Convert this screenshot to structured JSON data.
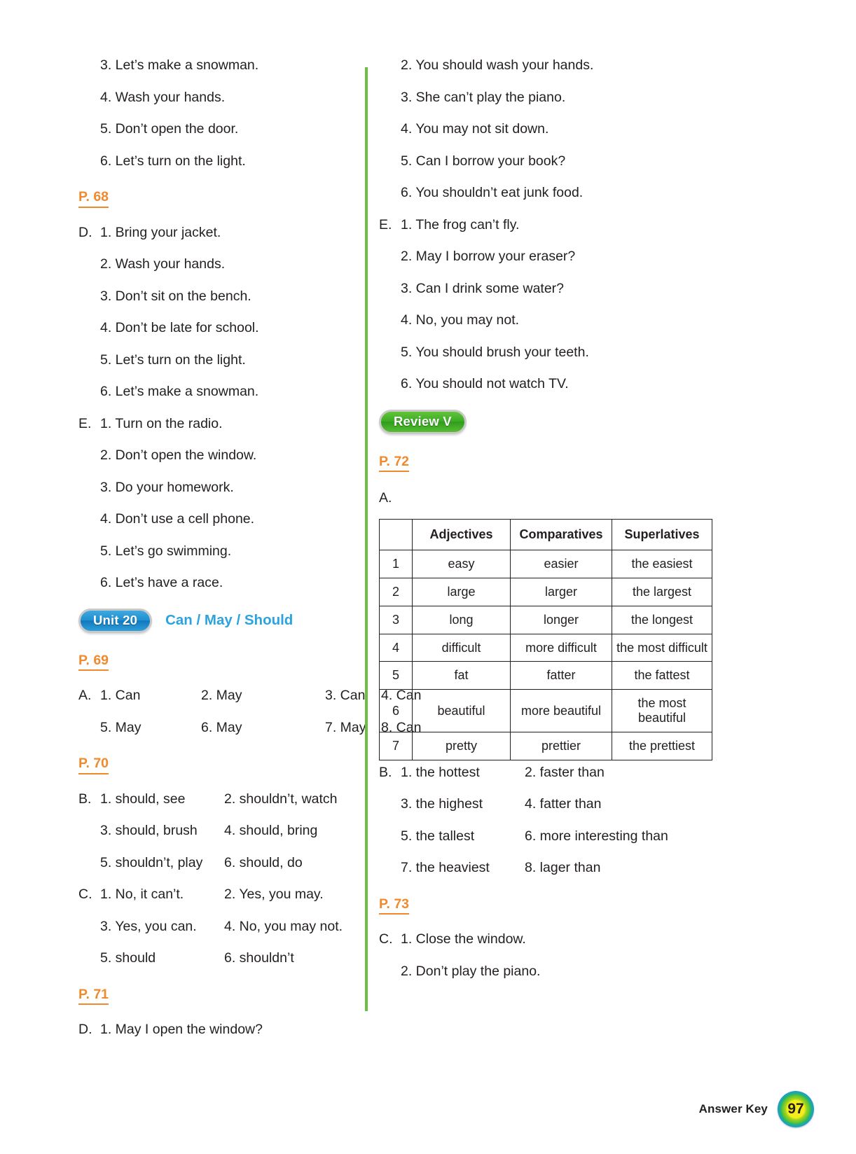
{
  "left_column": {
    "blocks": [
      {
        "type": "answers",
        "rows": [
          {
            "letter": "",
            "items": [
              "3. Let’s make a snowman."
            ]
          },
          {
            "letter": "",
            "items": [
              "4. Wash your hands."
            ]
          },
          {
            "letter": "",
            "items": [
              "5. Don’t open the door."
            ]
          },
          {
            "letter": "",
            "items": [
              "6. Let’s turn on the light."
            ]
          }
        ]
      },
      {
        "type": "page_marker",
        "label": "P. 68"
      },
      {
        "type": "answers",
        "rows": [
          {
            "letter": "D.",
            "items": [
              "1. Bring your jacket."
            ]
          },
          {
            "letter": "",
            "items": [
              "2. Wash your hands."
            ]
          },
          {
            "letter": "",
            "items": [
              "3. Don’t sit on the bench."
            ]
          },
          {
            "letter": "",
            "items": [
              "4. Don’t be late for school."
            ]
          },
          {
            "letter": "",
            "items": [
              "5. Let’s turn on the light."
            ]
          },
          {
            "letter": "",
            "items": [
              "6. Let’s make a snowman."
            ]
          },
          {
            "letter": "E.",
            "items": [
              "1. Turn on the radio."
            ]
          },
          {
            "letter": "",
            "items": [
              "2. Don’t open the window."
            ]
          },
          {
            "letter": "",
            "items": [
              "3. Do your homework."
            ]
          },
          {
            "letter": "",
            "items": [
              "4. Don’t use a cell phone."
            ]
          },
          {
            "letter": "",
            "items": [
              "5. Let’s go swimming."
            ]
          },
          {
            "letter": "",
            "items": [
              "6. Let’s have a race."
            ]
          }
        ]
      },
      {
        "type": "unit",
        "badge": "Unit 20",
        "title": "Can / May / Should",
        "badge_color": "#1e8fd0",
        "title_color": "#2ca3dd"
      },
      {
        "type": "page_marker",
        "label": "P. 69"
      },
      {
        "type": "answers_quad",
        "rows": [
          {
            "letter": "A.",
            "c1": "1. Can",
            "c2": "2. May",
            "c3": "3. Can",
            "c4": "4. Can"
          },
          {
            "letter": "",
            "c1": "5. May",
            "c2": "6. May",
            "c3": "7. May",
            "c4": "8. Can"
          }
        ]
      },
      {
        "type": "page_marker",
        "label": "P. 70"
      },
      {
        "type": "answers_two",
        "rows": [
          {
            "letter": "B.",
            "c1": "1. should, see",
            "c2": "2. shouldn’t, watch"
          },
          {
            "letter": "",
            "c1": "3. should, brush",
            "c2": "4. should, bring"
          },
          {
            "letter": "",
            "c1": "5. shouldn’t, play",
            "c2": "6. should, do"
          },
          {
            "letter": "C.",
            "c1": "1. No, it can’t.",
            "c2": "2. Yes, you may."
          },
          {
            "letter": "",
            "c1": "3. Yes, you can.",
            "c2": "4. No, you may not."
          },
          {
            "letter": "",
            "c1": "5. should",
            "c2": "6. shouldn’t"
          }
        ]
      },
      {
        "type": "page_marker",
        "label": "P. 71"
      },
      {
        "type": "answers",
        "rows": [
          {
            "letter": "D.",
            "items": [
              "1. May I open the window?"
            ]
          }
        ]
      }
    ]
  },
  "right_column": {
    "blocks": [
      {
        "type": "answers",
        "rows": [
          {
            "letter": "",
            "items": [
              "2. You should wash your hands."
            ]
          },
          {
            "letter": "",
            "items": [
              "3. She can’t play the piano."
            ]
          },
          {
            "letter": "",
            "items": [
              "4. You may not sit down."
            ]
          },
          {
            "letter": "",
            "items": [
              "5. Can I borrow your book?"
            ]
          },
          {
            "letter": "",
            "items": [
              "6. You shouldn’t eat junk food."
            ]
          },
          {
            "letter": "E.",
            "items": [
              "1. The frog can’t fly."
            ]
          },
          {
            "letter": "",
            "items": [
              "2. May I borrow your eraser?"
            ]
          },
          {
            "letter": "",
            "items": [
              "3. Can I drink some water?"
            ]
          },
          {
            "letter": "",
            "items": [
              "4. No, you may not."
            ]
          },
          {
            "letter": "",
            "items": [
              "5. You should brush your teeth."
            ]
          },
          {
            "letter": "",
            "items": [
              "6. You should not watch TV."
            ]
          }
        ]
      },
      {
        "type": "review",
        "badge": "Review V",
        "badge_color": "#3aab24"
      },
      {
        "type": "page_marker",
        "label": "P. 72"
      },
      {
        "type": "section_label",
        "label": "A."
      },
      {
        "type": "table"
      },
      {
        "type": "answers_two",
        "rows": [
          {
            "letter": "B.",
            "c1": "1. the hottest",
            "c2": "2. faster than"
          },
          {
            "letter": "",
            "c1": "3. the highest",
            "c2": "4. fatter than"
          },
          {
            "letter": "",
            "c1": "5. the tallest",
            "c2": "6. more interesting than"
          },
          {
            "letter": "",
            "c1": "7. the heaviest",
            "c2": "8. lager than"
          }
        ]
      },
      {
        "type": "page_marker",
        "label": "P. 73"
      },
      {
        "type": "answers",
        "rows": [
          {
            "letter": "C.",
            "items": [
              "1. Close the window."
            ]
          },
          {
            "letter": "",
            "items": [
              "2. Don’t play the piano."
            ]
          }
        ]
      }
    ]
  },
  "table": {
    "headers": [
      "",
      "Adjectives",
      "Comparatives",
      "Superlatives"
    ],
    "rows": [
      {
        "index": "1",
        "adjective": "easy",
        "comparative": "easier",
        "superlative": "the easiest"
      },
      {
        "index": "2",
        "adjective": "large",
        "comparative": "larger",
        "superlative": "the largest"
      },
      {
        "index": "3",
        "adjective": "long",
        "comparative": "longer",
        "superlative": "the longest"
      },
      {
        "index": "4",
        "adjective": "difficult",
        "comparative": "more difficult",
        "superlative": "the most difficult"
      },
      {
        "index": "5",
        "adjective": "fat",
        "comparative": "fatter",
        "superlative": "the fattest"
      },
      {
        "index": "6",
        "adjective": "beautiful",
        "comparative": "more beautiful",
        "superlative": "the most beautiful"
      },
      {
        "index": "7",
        "adjective": "pretty",
        "comparative": "prettier",
        "superlative": "the prettiest"
      }
    ]
  },
  "footer": {
    "label": "Answer Key",
    "page_number": "97"
  },
  "colors": {
    "marker_orange": "#f08a2e",
    "divider_green": "#6cbe45",
    "unit_blue": "#2ca3dd",
    "text": "#231f20"
  }
}
